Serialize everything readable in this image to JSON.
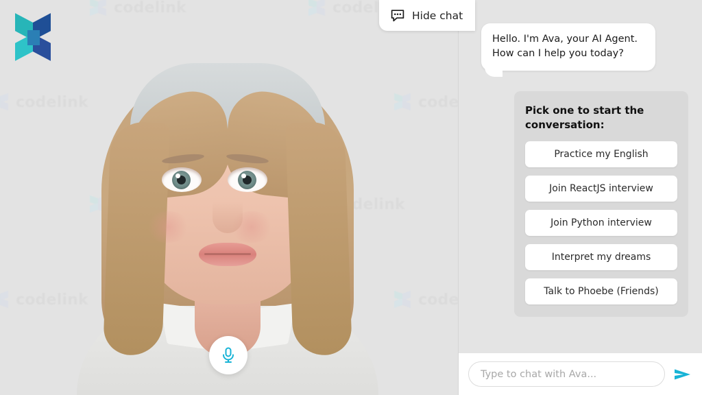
{
  "brand": {
    "logo_icon": "codelink-logo-icon",
    "watermark_text": "codelink"
  },
  "stage": {
    "hide_chat": {
      "label": "Hide chat",
      "icon": "chat-bubble-icon"
    },
    "mic_button": {
      "icon": "microphone-icon",
      "color": "#17b3d6"
    },
    "avatar_name": "Ava"
  },
  "chat": {
    "greeting": "Hello. I'm Ava, your AI Agent. How can I help you today?",
    "suggestions_title": "Pick one to start the conversation:",
    "suggestions": [
      "Practice my English",
      "Join ReactJS interview",
      "Join Python interview",
      "Interpret my dreams",
      "Talk to Phoebe (Friends)"
    ],
    "input": {
      "value": "",
      "placeholder": "Type to chat with Ava..."
    },
    "send_button": {
      "icon": "send-arrow-icon",
      "color": "#17b3d6"
    }
  },
  "colors": {
    "accent": "#17b3d6",
    "panel_bg": "#e4e4e4",
    "card_bg": "#d9d9d9",
    "logo_teal": "#2ec3c8",
    "logo_blue": "#1f4f96"
  }
}
